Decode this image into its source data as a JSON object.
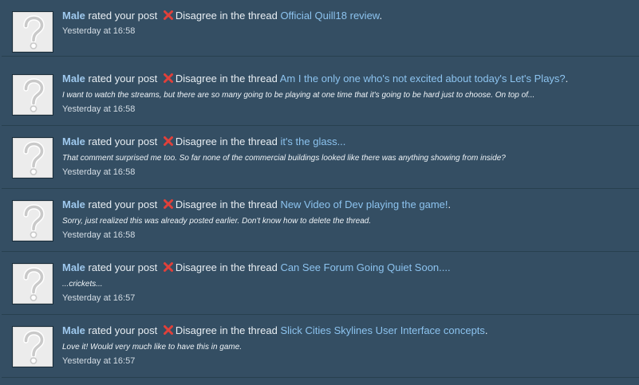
{
  "alerts": [
    {
      "username": "Male",
      "action": "rated your post",
      "rating": "Disagree",
      "in_thread": "in the thread",
      "thread_title": "Official Quill18 review",
      "trailing": ".",
      "snippet": "",
      "time": "Yesterday at 16:58"
    },
    {
      "username": "Male",
      "action": "rated your post",
      "rating": "Disagree",
      "in_thread": "in the thread",
      "thread_title": "Am I the only one who's not excited about today's Let's Plays?",
      "trailing": ".",
      "snippet": "I want to watch the streams, but there are so many going to be playing at one time that it's going to be hard just to choose. On top of...",
      "time": "Yesterday at 16:58"
    },
    {
      "username": "Male",
      "action": "rated your post",
      "rating": "Disagree",
      "in_thread": "in the thread",
      "thread_title": "it's the glass...",
      "trailing": "",
      "snippet": "That comment surprised me too. So far none of the commercial buildings looked like there was anything showing from inside?",
      "time": "Yesterday at 16:58"
    },
    {
      "username": "Male",
      "action": "rated your post",
      "rating": "Disagree",
      "in_thread": "in the thread",
      "thread_title": "New Video of Dev playing the game!",
      "trailing": ".",
      "snippet": "Sorry, just realized this was already posted earlier. Don't know how to delete the thread.",
      "time": "Yesterday at 16:58"
    },
    {
      "username": "Male",
      "action": "rated your post",
      "rating": "Disagree",
      "in_thread": "in the thread",
      "thread_title": "Can See Forum Going Quiet Soon....",
      "trailing": "",
      "snippet": "...crickets...",
      "time": "Yesterday at 16:57"
    },
    {
      "username": "Male",
      "action": "rated your post",
      "rating": "Disagree",
      "in_thread": "in the thread",
      "thread_title": "Slick Cities Skylines User Interface concepts",
      "trailing": ".",
      "snippet": "Love it! Would very much like to have this in game.",
      "time": "Yesterday at 16:57"
    }
  ],
  "icons": {
    "avatar": "default-avatar-question-mark-icon",
    "rating": "disagree-red-x-icon"
  },
  "colors": {
    "background": "#344e63",
    "link": "#8cc3ef",
    "username": "#9fc9ee",
    "text": "#e8eef3",
    "disagree": "#e0403a"
  }
}
